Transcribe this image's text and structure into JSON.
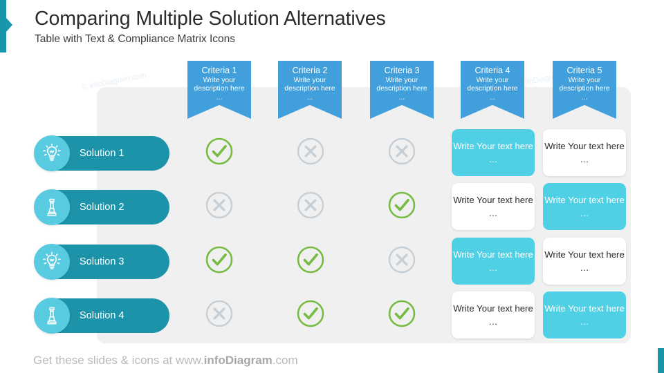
{
  "header": {
    "title": "Comparing Multiple Solution Alternatives",
    "subtitle": "Table with Text & Compliance Matrix Icons"
  },
  "watermarks": {
    "left": "© infoDiagram.com",
    "right": "© infoDiagram.com"
  },
  "colors": {
    "accent_teal": "#1a96ab",
    "solution_pill": "#1c93a9",
    "solution_badge": "#59cbe0",
    "criteria_banner": "#41a0dc",
    "panel_grey": "#f0f0f0",
    "check_green": "#76bc43",
    "cross_grey": "#c6ced6",
    "textbox_fill": "#4fd0e4"
  },
  "criteria": [
    {
      "title": "Criteria 1",
      "description": "Write your description here",
      "dots": "..."
    },
    {
      "title": "Criteria 2",
      "description": "Write your description here",
      "dots": "..."
    },
    {
      "title": "Criteria 3",
      "description": "Write your description here",
      "dots": "..."
    },
    {
      "title": "Criteria 4",
      "description": "Write your description here",
      "dots": "..."
    },
    {
      "title": "Criteria 5",
      "description": "Write your description here",
      "dots": "..."
    }
  ],
  "solutions": [
    {
      "label": "Solution 1",
      "icon": "lightbulb-icon"
    },
    {
      "label": "Solution 2",
      "icon": "chess-pawn-icon"
    },
    {
      "label": "Solution 3",
      "icon": "lightbulb-icon"
    },
    {
      "label": "Solution 4",
      "icon": "chess-pawn-icon"
    }
  ],
  "matrix": {
    "marks": [
      [
        "check",
        "cross",
        "cross"
      ],
      [
        "cross",
        "cross",
        "check"
      ],
      [
        "check",
        "check",
        "cross"
      ],
      [
        "cross",
        "check",
        "check"
      ]
    ],
    "textboxes": [
      [
        {
          "text": "Write Your text here …",
          "style": "filled"
        },
        {
          "text": "Write Your text here …",
          "style": "empty"
        }
      ],
      [
        {
          "text": "Write Your text here …",
          "style": "empty"
        },
        {
          "text": "Write Your text here …",
          "style": "filled"
        }
      ],
      [
        {
          "text": "Write Your text here …",
          "style": "filled"
        },
        {
          "text": "Write Your text here …",
          "style": "empty"
        }
      ],
      [
        {
          "text": "Write Your text here …",
          "style": "empty"
        },
        {
          "text": "Write Your text here …",
          "style": "filled"
        }
      ]
    ]
  },
  "footer": {
    "prefix": "Get these slides  & icons at www.",
    "brand": "infoDiagram",
    "suffix": ".com"
  }
}
